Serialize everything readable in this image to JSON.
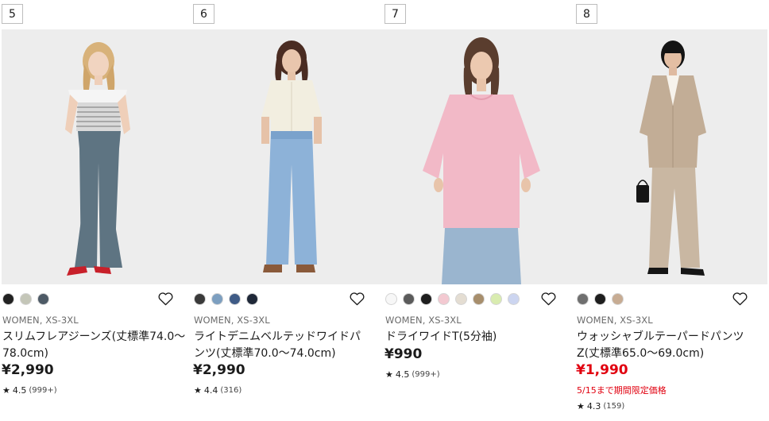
{
  "products": [
    {
      "rank": "5",
      "swatches": [
        "#222222",
        "#c4c6b8",
        "#4d5a66"
      ],
      "meta": "WOMEN, XS-3XL",
      "name_line1": "スリムフレアジーンズ(丈標準74.0〜",
      "name_line2": "78.0cm)",
      "price": "¥2,990",
      "rating_value": "4.5",
      "rating_count": "(999+)",
      "photo_icon": "model-photo-flare-jeans"
    },
    {
      "rank": "6",
      "swatches": [
        "#3a3a3a",
        "#7d9fc0",
        "#3f5b86",
        "#1f2838"
      ],
      "meta": "WOMEN, XS-3XL",
      "name_line1": "ライトデニムベルテッドワイドパ",
      "name_line2": "ンツ(丈標準70.0〜74.0cm)",
      "price": "¥2,990",
      "rating_value": "4.4",
      "rating_count": "(316)",
      "photo_icon": "model-photo-wide-pants"
    },
    {
      "rank": "7",
      "swatches": [
        "#f7f7f7",
        "#5b5b5b",
        "#1e1e1e",
        "#f3c9d1",
        "#e4ddd2",
        "#a78e6c",
        "#d9ecb0",
        "#ccd5f0"
      ],
      "meta": "WOMEN, XS-3XL",
      "name_line1": "ドライワイドT(5分袖)",
      "name_line2": "",
      "price": "¥990",
      "rating_value": "4.5",
      "rating_count": "(999+)",
      "photo_icon": "model-photo-wide-tee"
    },
    {
      "rank": "8",
      "swatches": [
        "#6f6f6f",
        "#1e1e1e",
        "#c7ac93"
      ],
      "meta": "WOMEN, XS-3XL",
      "name_line1": "ウォッシャブルテーパードパンツ",
      "name_line2": "Z(丈標準65.0〜69.0cm)",
      "price": "¥1,990",
      "promo": "5/15まで期間限定価格",
      "rating_value": "4.3",
      "rating_count": "(159)",
      "photo_icon": "model-photo-tapered-pants"
    }
  ],
  "rating_star": "★",
  "sale_color": "#e1000f"
}
